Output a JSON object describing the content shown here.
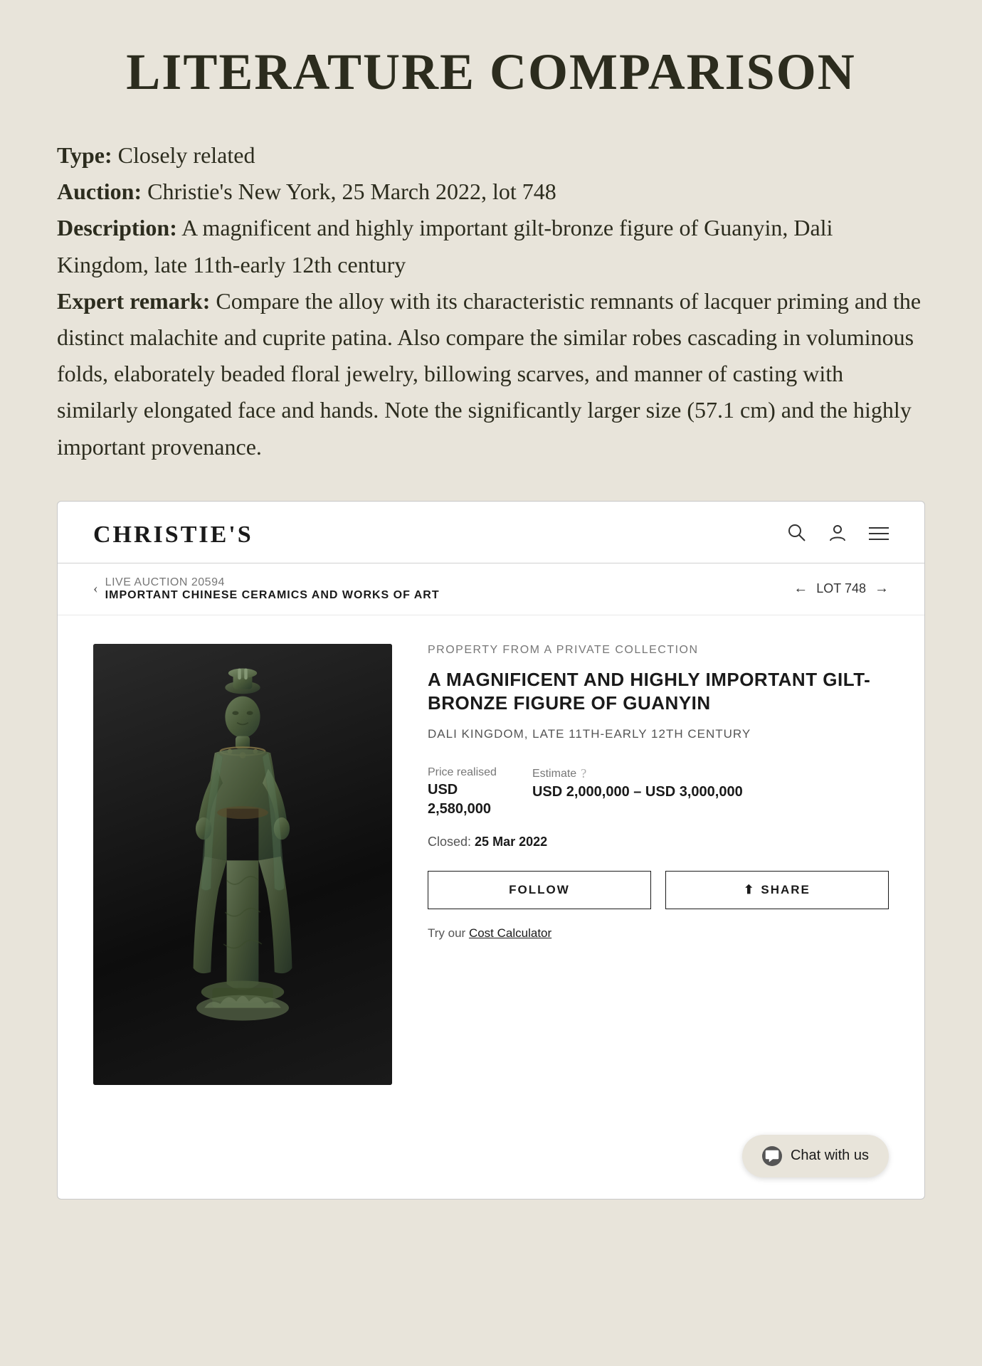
{
  "page": {
    "title": "LITERATURE COMPARISON",
    "background_color": "#e8e4da"
  },
  "literature": {
    "type_label": "Type:",
    "type_value": "Closely related",
    "auction_label": "Auction:",
    "auction_value": "Christie's New York, 25 March 2022, lot 748",
    "description_label": "Description:",
    "description_value": "A magnificent and highly important gilt-bronze figure of Guanyin, Dali Kingdom, late 11th-early 12th century",
    "expert_label": "Expert remark:",
    "expert_value": "Compare the alloy with its characteristic remnants of lacquer priming and the distinct malachite and cuprite patina. Also compare the similar robes cascading in voluminous folds, elaborately beaded floral jewelry, billowing scarves, and manner of casting with similarly elongated face and hands. Note the significantly larger size (57.1 cm) and the highly important provenance."
  },
  "christies": {
    "logo": "CHRISTIE'S",
    "nav": {
      "search_label": "search-icon",
      "user_label": "user-icon",
      "menu_label": "menu-icon"
    },
    "breadcrumb": {
      "back_chevron": "‹",
      "auction_id": "LIVE AUCTION 20594",
      "auction_name": "IMPORTANT CHINESE CERAMICS AND WORKS OF ART",
      "lot_back": "←",
      "lot_label": "LOT 748",
      "lot_forward": "→"
    },
    "lot": {
      "property_from": "PROPERTY FROM A PRIVATE COLLECTION",
      "title": "A MAGNIFICENT AND HIGHLY IMPORTANT GILT-BRONZE FIGURE OF GUANYIN",
      "subtitle": "DALI KINGDOM, LATE 11TH-EARLY 12TH CENTURY",
      "price_realised_label": "Price realised",
      "price_realised_currency": "USD",
      "price_realised_value": "2,580,000",
      "estimate_label": "Estimate",
      "estimate_value": "USD 2,000,000 – USD 3,000,000",
      "closed_label": "Closed:",
      "closed_date": "25 Mar 2022",
      "follow_button": "FOLLOW",
      "share_icon": "⬆",
      "share_button": "SHARE",
      "cost_calc_prefix": "Try our",
      "cost_calc_link": "Cost Calculator"
    },
    "chat": {
      "button_label": "Chat with us"
    }
  }
}
